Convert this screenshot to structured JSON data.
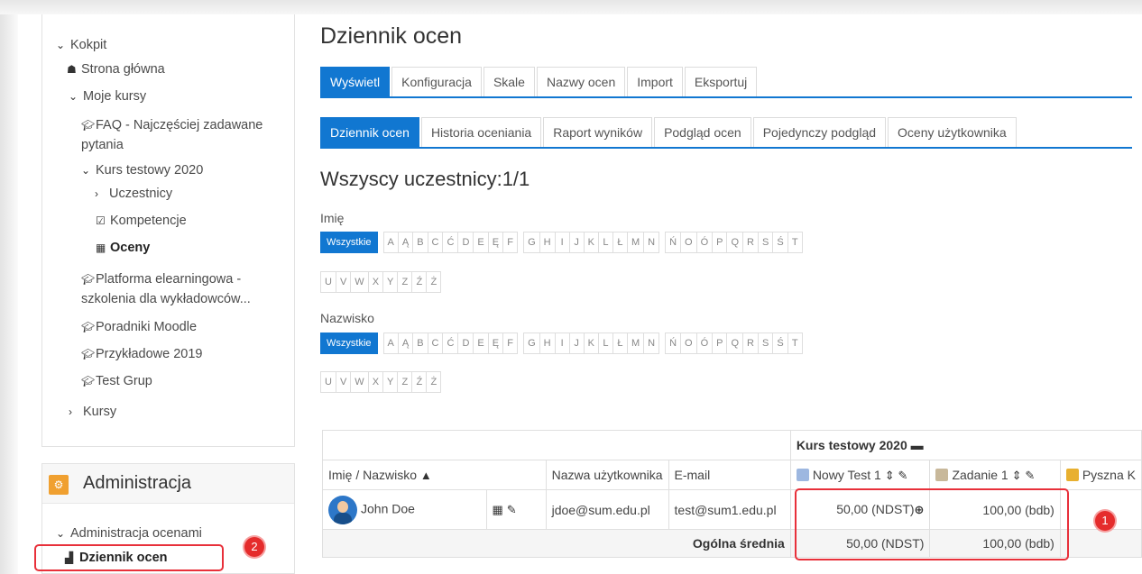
{
  "sidebar": {
    "nav": {
      "kokpit": "Kokpit",
      "strona_glowna": "Strona główna",
      "moje_kursy": "Moje kursy",
      "faq": "FAQ - Najczęściej zadawane pytania",
      "kurs_testowy": "Kurs testowy 2020",
      "uczestnicy": "Uczestnicy",
      "kompetencje": "Kompetencje",
      "oceny": "Oceny",
      "platforma": "Platforma elearningowa - szkolenia dla wykładowców...",
      "poradniki": "Poradniki Moodle",
      "przykladowe": "Przykładowe 2019",
      "test_grup": "Test Grup",
      "kursy": "Kursy"
    },
    "admin": {
      "title": "Administracja",
      "administracja_ocenami": "Administracja ocenami",
      "dziennik_ocen": "Dziennik ocen"
    }
  },
  "main": {
    "title": "Dziennik ocen",
    "tabs_top": [
      "Wyświetl",
      "Konfiguracja",
      "Skale",
      "Nazwy ocen",
      "Import",
      "Eksportuj"
    ],
    "tabs_sub": [
      "Dziennik ocen",
      "Historia oceniania",
      "Raport wyników",
      "Podgląd ocen",
      "Pojedynczy podgląd",
      "Oceny użytkownika"
    ],
    "participants_title": "Wszyscy uczestnicy:1/1",
    "filter_first_label": "Imię",
    "filter_last_label": "Nazwisko",
    "all_label": "Wszystkie",
    "letters_row1_a": [
      "A",
      "Ą",
      "B",
      "C",
      "Ć",
      "D",
      "E",
      "Ę",
      "F"
    ],
    "letters_row1_b": [
      "G",
      "H",
      "I",
      "J",
      "K",
      "L",
      "Ł",
      "M",
      "N"
    ],
    "letters_row1_c": [
      "Ń",
      "O",
      "Ó",
      "P",
      "Q",
      "R",
      "S",
      "Ś",
      "T"
    ],
    "letters_row2": [
      "U",
      "V",
      "W",
      "X",
      "Y",
      "Z",
      "Ź",
      "Ż"
    ]
  },
  "grades": {
    "course_header": "Kurs testowy 2020",
    "col_name": "Imię / Nazwisko",
    "col_username": "Nazwa użytkownika",
    "col_email": "E-mail",
    "col_item1": "Nowy Test 1",
    "col_item2": "Zadanie 1",
    "col_item3": "Pyszna K",
    "user": {
      "name": "John Doe",
      "username": "jdoe@sum.edu.pl",
      "email": "test@sum1.edu.pl",
      "grade1": "50,00 (NDST)",
      "grade2": "100,00 (bdb)"
    },
    "avg_label": "Ogólna średnia",
    "avg1": "50,00 (NDST)",
    "avg2": "100,00 (bdb)"
  },
  "badges": {
    "one": "1",
    "two": "2"
  },
  "colors": {
    "accent": "#1177d1",
    "highlight": "#e8303a",
    "admin_icon": "#f0a030"
  }
}
